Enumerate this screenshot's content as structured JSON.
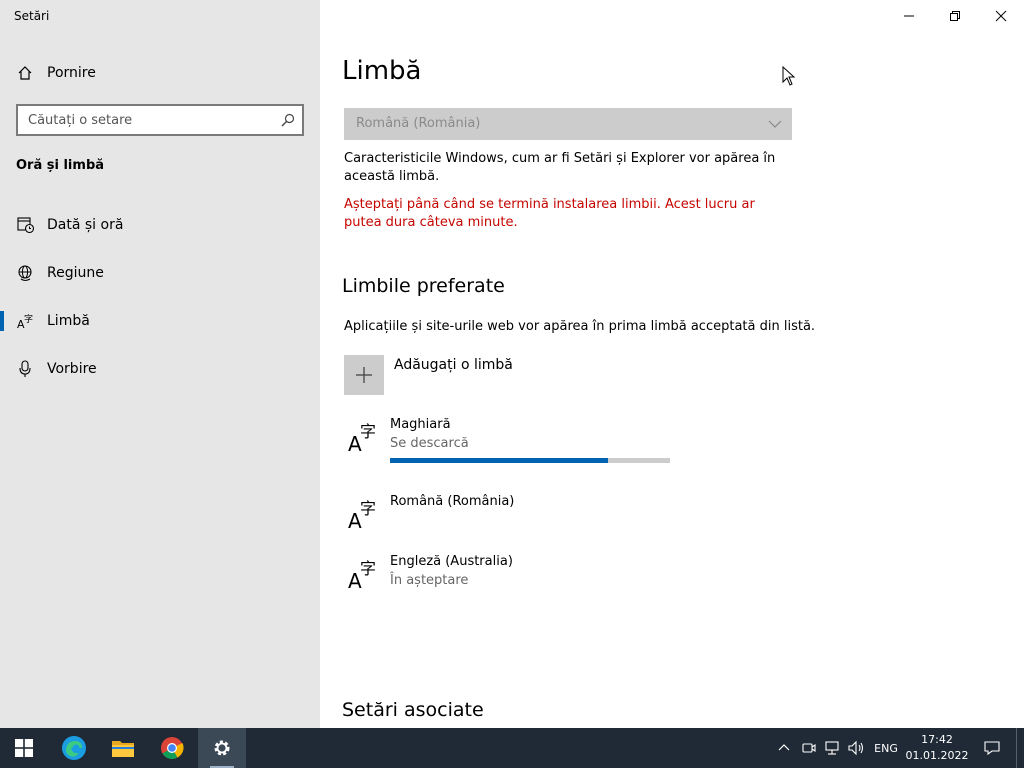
{
  "window": {
    "title": "Setări"
  },
  "sidebar": {
    "home_label": "Pornire",
    "search_placeholder": "Căutați o setare",
    "section_title": "Oră și limbă",
    "items": [
      {
        "label": "Dată și oră",
        "icon": "calendar-clock-icon"
      },
      {
        "label": "Regiune",
        "icon": "globe-icon"
      },
      {
        "label": "Limbă",
        "icon": "language-icon",
        "selected": true
      },
      {
        "label": "Vorbire",
        "icon": "microphone-icon"
      }
    ]
  },
  "main": {
    "title": "Limbă",
    "display_language": {
      "value": "Română (România)",
      "description": "Caracteristicile Windows, cum ar fi Setări și Explorer vor apărea în această limbă.",
      "warning": "Așteptați până când se termină instalarea limbii. Acest lucru ar putea dura câteva minute."
    },
    "preferred": {
      "title": "Limbile preferate",
      "description": "Aplicațiile și site-urile web vor apărea în prima limbă acceptată din listă.",
      "add_label": "Adăugați o limbă",
      "languages": [
        {
          "name": "Maghiară",
          "status": "Se descarcă",
          "progress_percent": 78
        },
        {
          "name": "Română (România)",
          "status": ""
        },
        {
          "name": "Engleză (Australia)",
          "status": "În așteptare"
        }
      ]
    },
    "related_title": "Setări asociate"
  },
  "taskbar": {
    "apps": [
      "start-icon",
      "edge-icon",
      "file-explorer-icon",
      "chrome-icon",
      "settings-icon"
    ],
    "language": "ENG",
    "time": "17:42",
    "date": "01.01.2022"
  },
  "colors": {
    "accent": "#0063b1",
    "warning": "#c50500",
    "sidebar_bg": "#e6e6e6",
    "taskbar_bg": "#1f2a36"
  }
}
